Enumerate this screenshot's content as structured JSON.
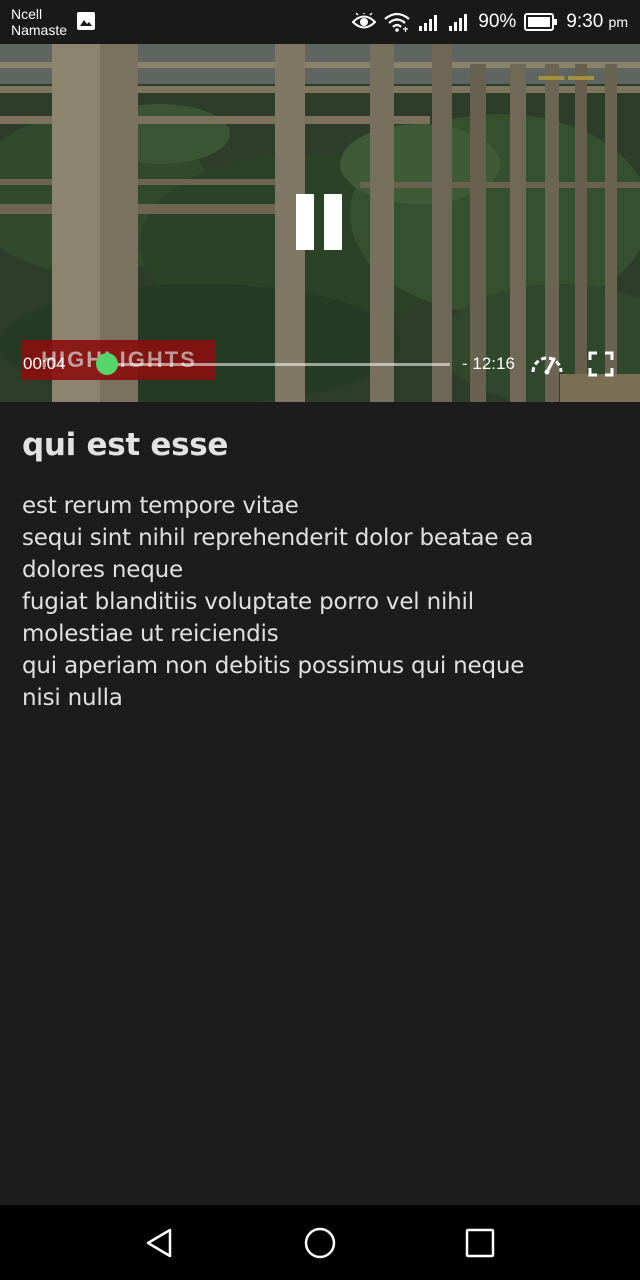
{
  "status_bar": {
    "carrier_line1": "Ncell",
    "carrier_line2": "Namaste",
    "battery_percent": "90%",
    "time": "9:30",
    "ampm": "pm",
    "icons": [
      "gallery-icon",
      "eye-icon",
      "wifi-icon",
      "signal-icon",
      "signal-icon",
      "battery-icon"
    ]
  },
  "video": {
    "banner_text": "HIGHLIGHTS",
    "current_time": "00:04",
    "remaining_time": "- 12:16",
    "progress": 0.01,
    "playing": true,
    "accent_color": "#55d56b"
  },
  "post": {
    "title": "qui est esse",
    "body_lines": [
      "est rerum tempore vitae",
      "sequi sint nihil reprehenderit dolor beatae ea",
      "dolores neque",
      "fugiat blanditiis voluptate porro vel nihil",
      "molestiae ut reiciendis",
      "qui aperiam non debitis possimus qui neque",
      "nisi nulla"
    ]
  },
  "nav_bar": {
    "icons": [
      "back-icon",
      "home-icon",
      "recent-apps-icon"
    ]
  }
}
